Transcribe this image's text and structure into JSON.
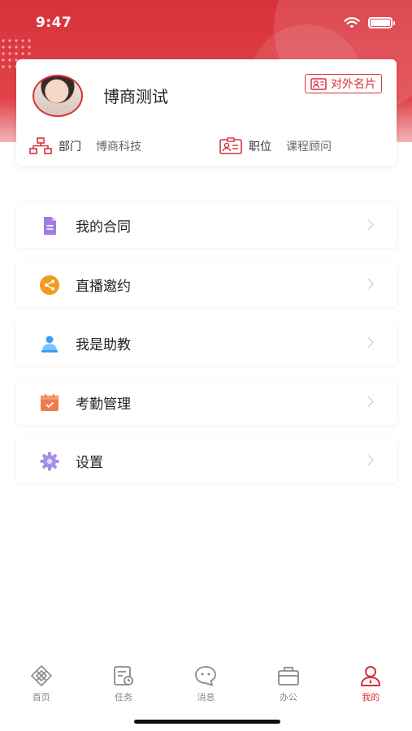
{
  "status_bar": {
    "time": "9:47"
  },
  "profile": {
    "name": "博商测试",
    "card_button_label": "对外名片",
    "department": {
      "label": "部门",
      "value": "博商科技"
    },
    "position": {
      "label": "职位",
      "value": "课程顾问"
    }
  },
  "menu": {
    "items": [
      {
        "label": "我的合同",
        "icon": "contract-document-icon",
        "color": "#a07de0"
      },
      {
        "label": "直播邀约",
        "icon": "share-icon",
        "color": "#f39a1e"
      },
      {
        "label": "我是助教",
        "icon": "assistant-person-icon",
        "color": "#3a9ef5"
      },
      {
        "label": "考勤管理",
        "icon": "calendar-check-icon",
        "color": "#f07b4a"
      },
      {
        "label": "设置",
        "icon": "gear-icon",
        "color": "#a58ee8"
      }
    ]
  },
  "tabbar": {
    "tabs": [
      {
        "label": "首页",
        "icon": "home-icon",
        "active": false
      },
      {
        "label": "任务",
        "icon": "task-icon",
        "active": false
      },
      {
        "label": "消息",
        "icon": "message-icon",
        "active": false
      },
      {
        "label": "办公",
        "icon": "briefcase-icon",
        "active": false
      },
      {
        "label": "我的",
        "icon": "person-icon",
        "active": true
      }
    ]
  },
  "colors": {
    "accent": "#d8313a",
    "active_tab": "#d8313a",
    "inactive_tab": "#888888"
  }
}
